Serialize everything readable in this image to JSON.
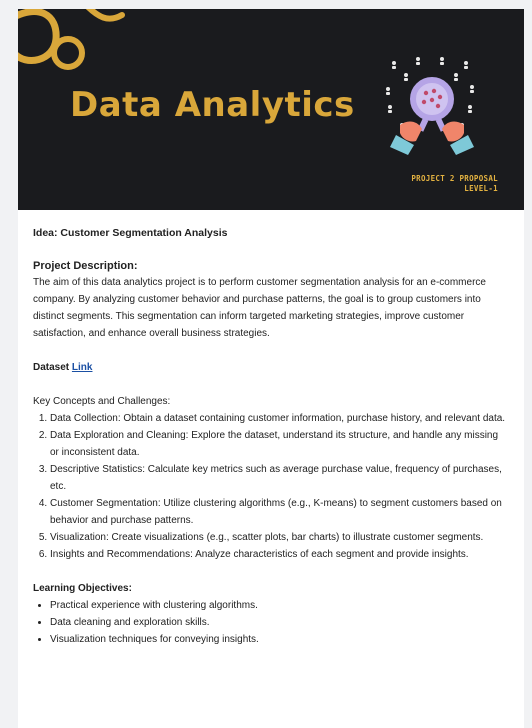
{
  "banner": {
    "title": "Data Analytics",
    "subtitle_line1": "PROJECT 2 PROPOSAL",
    "subtitle_line2": "LEVEL-1"
  },
  "idea": "Idea: Customer Segmentation Analysis",
  "description": {
    "heading": "Project Description:",
    "text": "The aim of this data analytics project is to perform customer segmentation analysis for an e-commerce company. By analyzing customer behavior and purchase patterns, the goal is to group customers into distinct segments. This segmentation can inform targeted marketing strategies, improve customer satisfaction, and enhance overall business strategies."
  },
  "dataset": {
    "label": "Dataset",
    "link_text": "Link"
  },
  "key_concepts": {
    "title": "Key Concepts and Challenges:",
    "items": [
      "Data Collection: Obtain a dataset containing customer information, purchase history, and relevant data.",
      "Data Exploration and Cleaning: Explore the dataset, understand its structure, and handle any missing or inconsistent data.",
      "Descriptive Statistics: Calculate key metrics such as average purchase value, frequency of purchases, etc.",
      "Customer Segmentation: Utilize clustering algorithms (e.g., K-means) to segment customers based on behavior and purchase patterns.",
      "Visualization: Create visualizations (e.g., scatter plots, bar charts) to illustrate customer segments.",
      "Insights and Recommendations: Analyze characteristics of each segment and provide insights."
    ]
  },
  "learning_objectives": {
    "title": "Learning Objectives:",
    "items": [
      "Practical experience with clustering algorithms.",
      "Data cleaning and exploration skills.",
      "Visualization techniques for conveying insights."
    ]
  },
  "colors": {
    "banner_bg": "#1a1b1e",
    "gold": "#d9a73a",
    "link": "#1a4fa3",
    "magnifier": "#b5a4e6",
    "hand": "#f0856a",
    "sleeve": "#7ec9d8"
  },
  "icons": [
    "swirl-decoration",
    "magnifier-people-illustration"
  ]
}
